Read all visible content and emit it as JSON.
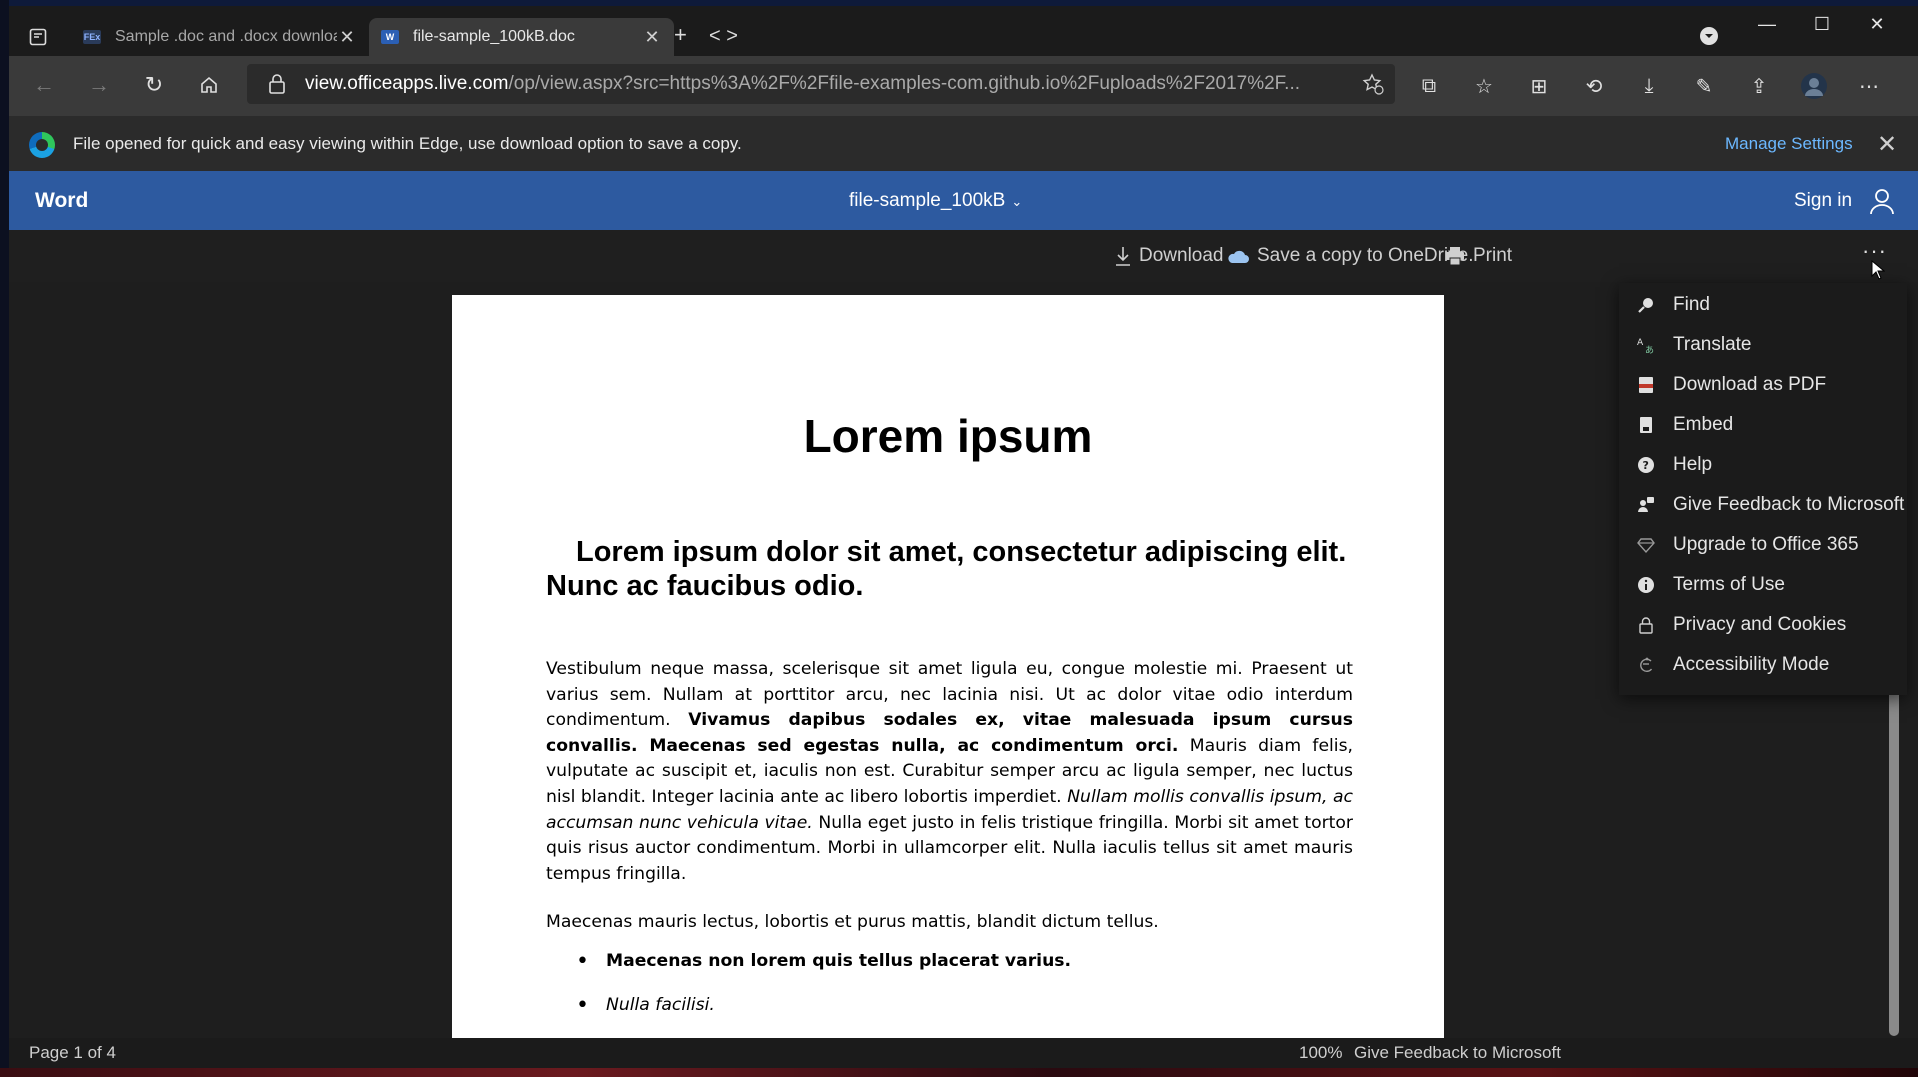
{
  "browser": {
    "tabs": [
      {
        "title": "Sample .doc and .docx download",
        "favicon": "FEx"
      },
      {
        "title": "file-sample_100kB.doc",
        "favicon": "W"
      }
    ],
    "address": {
      "host": "view.officeapps.live.com",
      "path": "/op/view.aspx?src=https%3A%2F%2Ffile-examples-com.github.io%2Fuploads%2F2017%2F..."
    },
    "infobar": {
      "message": "File opened for quick and easy viewing within Edge, use download option to save a copy.",
      "manage_label": "Manage Settings"
    }
  },
  "word": {
    "app_name": "Word",
    "doc_name": "file-sample_100kB",
    "signin_label": "Sign in",
    "commands": {
      "download": "Download",
      "save_copy": "Save a copy to OneDrive.",
      "print": "Print"
    },
    "menu": [
      {
        "label": "Find",
        "icon": "search-icon"
      },
      {
        "label": "Translate",
        "icon": "translate-icon"
      },
      {
        "label": "Download as PDF",
        "icon": "pdf-icon"
      },
      {
        "label": "Embed",
        "icon": "embed-icon"
      },
      {
        "label": "Help",
        "icon": "help-icon"
      },
      {
        "label": "Give Feedback to Microsoft",
        "icon": "feedback-icon"
      },
      {
        "label": "Upgrade to Office 365",
        "icon": "diamond-icon"
      },
      {
        "label": "Terms of Use",
        "icon": "info-icon"
      },
      {
        "label": "Privacy and Cookies",
        "icon": "lock-icon"
      },
      {
        "label": "Accessibility Mode",
        "icon": "accessibility-icon"
      }
    ],
    "status": {
      "page": "Page 1 of 4",
      "zoom": "100%",
      "feedback": "Give Feedback to Microsoft"
    }
  },
  "document": {
    "title": "Lorem ipsum",
    "heading": "Lorem ipsum dolor sit amet, consectetur adipiscing elit. Nunc ac faucibus odio.",
    "para1": {
      "t1": "Vestibulum neque massa, scelerisque sit amet ligula eu, congue molestie mi. Praesent ut varius sem. Nullam at porttitor arcu, nec lacinia nisi. Ut ac dolor vitae odio interdum condimentum. ",
      "b1": "Vivamus dapibus sodales ex, vitae malesuada ipsum cursus convallis. Maecenas sed egestas nulla, ac condimentum orci.",
      "t2": " Mauris diam felis, vulputate ac suscipit et, iaculis non est. Curabitur semper arcu ac ligula semper, nec luctus nisl blandit. Integer lacinia ante ac libero lobortis imperdiet. ",
      "i1": "Nullam mollis convallis ipsum, ac accumsan nunc vehicula vitae.",
      "t3": " Nulla eget justo in felis tristique fringilla. Morbi sit amet tortor quis risus auctor condimentum. Morbi in ullamcorper elit. Nulla iaculis tellus sit amet mauris tempus fringilla."
    },
    "para2": "Maecenas mauris lectus, lobortis et purus mattis, blandit dictum tellus.",
    "bullets": [
      "Maecenas non lorem quis tellus placerat varius.",
      "Nulla facilisi."
    ]
  },
  "colors": {
    "word_blue": "#2d5aa0",
    "link_blue": "#6cb8ff",
    "chrome_dark": "#1b1b1b"
  }
}
